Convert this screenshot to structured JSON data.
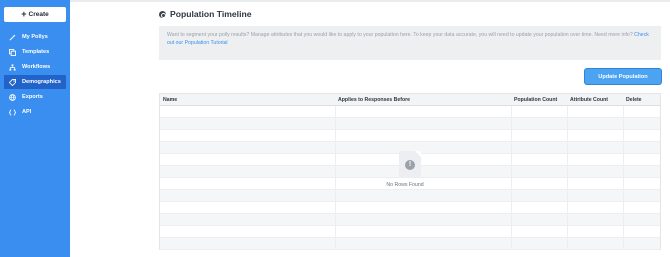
{
  "sidebar": {
    "create_label": "Create",
    "items": [
      {
        "label": "My Pollys",
        "icon": "magic-wand-icon",
        "active": false
      },
      {
        "label": "Templates",
        "icon": "templates-icon",
        "active": false
      },
      {
        "label": "Workflows",
        "icon": "workflow-icon",
        "active": false
      },
      {
        "label": "Demographics",
        "icon": "demographics-icon",
        "active": true
      },
      {
        "label": "Exports",
        "icon": "exports-icon",
        "active": false
      },
      {
        "label": "API",
        "icon": "api-icon",
        "active": false
      }
    ]
  },
  "page": {
    "title": "Population Timeline",
    "info_text": "Want to segment your polly results? Manage attributes that you would like to apply to your population here. To keep your data accurate, you will need to update your population over time. Need more info?",
    "info_link": "Check out our Population Tutorial",
    "update_button": "Update Population"
  },
  "table": {
    "columns": [
      "Name",
      "Applies to Responses Before",
      "Population Count",
      "Attribute Count",
      "Delete"
    ],
    "empty_message": "No Rows Found"
  },
  "colors": {
    "sidebar": "#3a8ef0",
    "sidebar_active": "#2263c9",
    "primary_button": "#4ba3f2",
    "link": "#3a8ef0"
  }
}
